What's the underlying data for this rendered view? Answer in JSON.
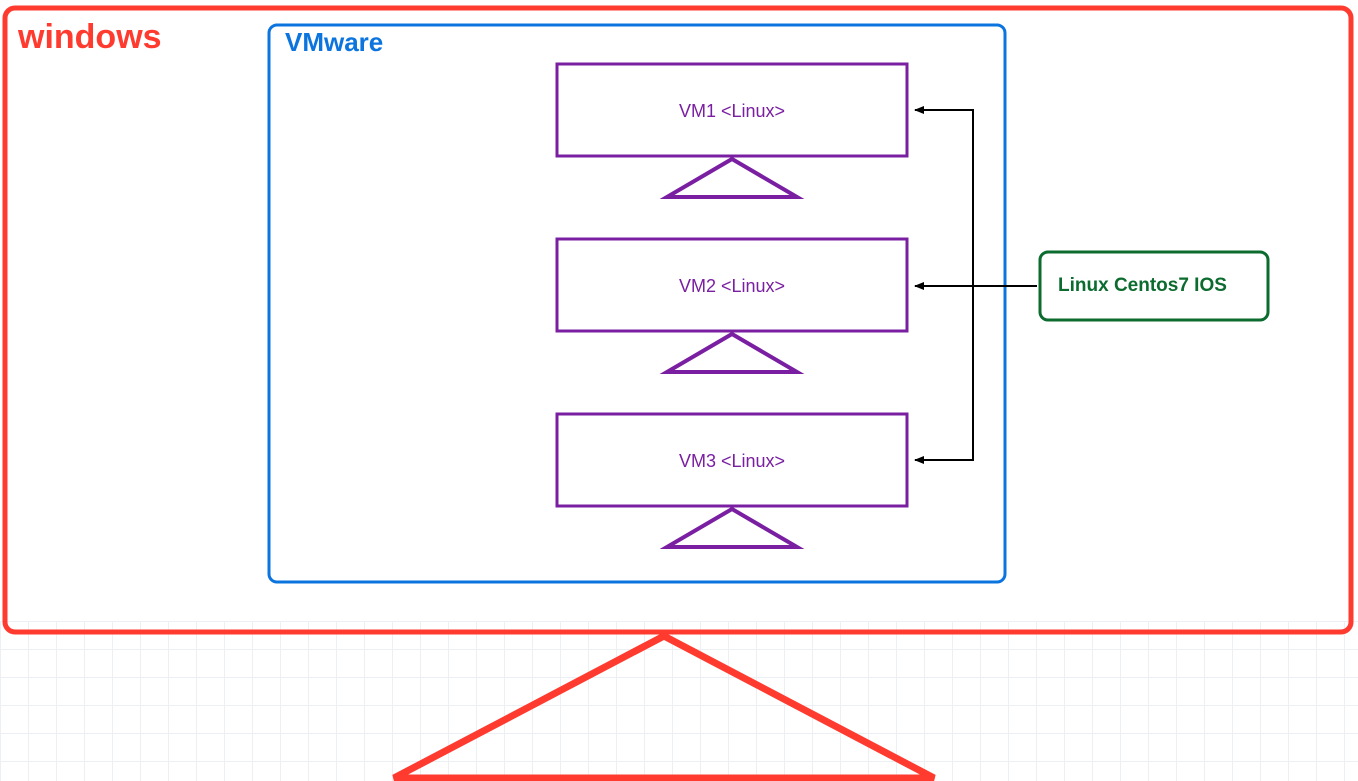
{
  "host": {
    "label": "windows",
    "color": "#ff3b30"
  },
  "hypervisor": {
    "label": "VMware",
    "color": "#0b74de"
  },
  "vms": [
    {
      "label": "VM1 <Linux>"
    },
    {
      "label": "VM2 <Linux>"
    },
    {
      "label": "VM3 <Linux>"
    }
  ],
  "iso": {
    "label": "Linux Centos7 IOS",
    "color": "#0c6b2e"
  },
  "colors": {
    "vm": "#7a1fa2",
    "arrow": "#000000"
  }
}
